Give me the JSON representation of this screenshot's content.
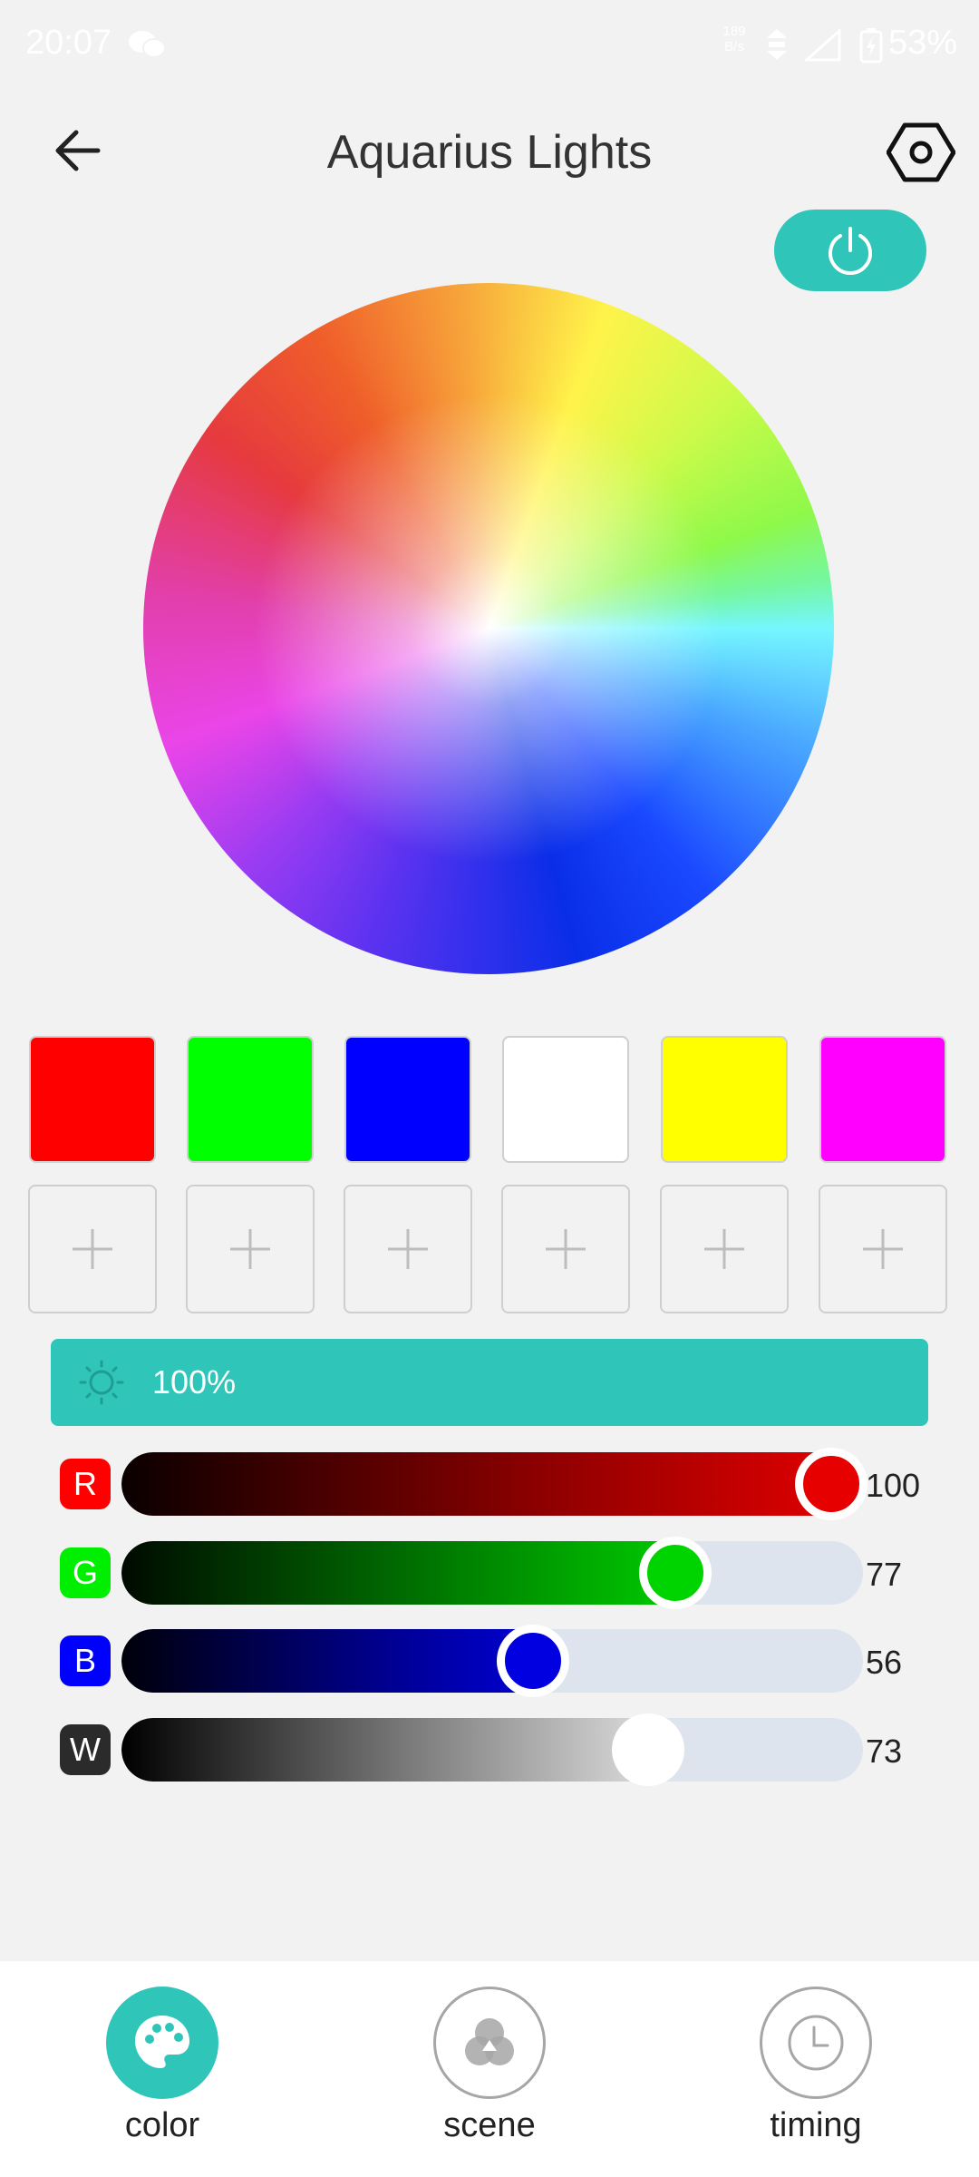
{
  "status_bar": {
    "time": "20:07",
    "net_speed_value": "189",
    "net_speed_unit": "B/s",
    "battery": "53%"
  },
  "header": {
    "title": "Aquarius Lights"
  },
  "presets": [
    {
      "color": "#ff0000"
    },
    {
      "color": "#00ff00"
    },
    {
      "color": "#0000ff"
    },
    {
      "color": "#ffffff"
    },
    {
      "color": "#ffff00"
    },
    {
      "color": "#ff00ff"
    }
  ],
  "custom_slot_symbol": "+",
  "brightness": {
    "value": "100%"
  },
  "sliders": [
    {
      "label": "R",
      "value": "100",
      "fraction": 1.0,
      "color": "#e60000"
    },
    {
      "label": "G",
      "value": "77",
      "fraction": 0.77,
      "color": "#00d400"
    },
    {
      "label": "B",
      "value": "56",
      "fraction": 0.56,
      "color": "#0000e0"
    },
    {
      "label": "W",
      "value": "73",
      "fraction": 0.73,
      "color": "#ffffff"
    }
  ],
  "accent_color": "#2fc5b8",
  "nav": [
    {
      "label": "color",
      "icon": "palette-icon",
      "active": true
    },
    {
      "label": "scene",
      "icon": "scene-icon",
      "active": false
    },
    {
      "label": "timing",
      "icon": "clock-icon",
      "active": false
    }
  ]
}
